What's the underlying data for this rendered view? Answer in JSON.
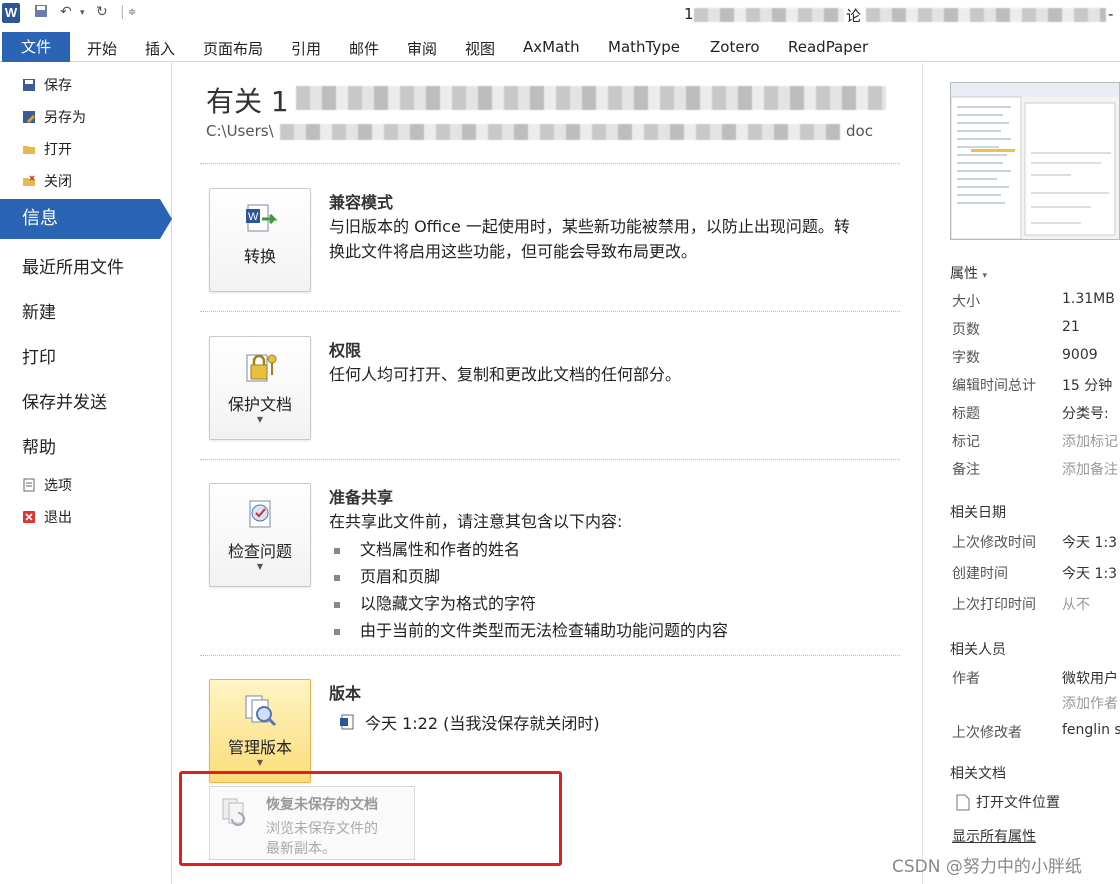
{
  "titlebar": {
    "title_prefix": "1",
    "title_suffix": "论",
    "title_end": "-"
  },
  "ribbon": {
    "file_tab": "文件",
    "tabs": [
      "开始",
      "插入",
      "页面布局",
      "引用",
      "邮件",
      "审阅",
      "视图",
      "AxMath",
      "MathType",
      "Zotero",
      "ReadPaper"
    ]
  },
  "nav": {
    "commands": [
      "保存",
      "另存为",
      "打开",
      "关闭"
    ],
    "info": "信息",
    "items": [
      "最近所用文件",
      "新建",
      "打印",
      "保存并发送",
      "帮助"
    ],
    "bottom": [
      "选项",
      "退出"
    ]
  },
  "main": {
    "title": "有关 1",
    "path_start": "C:\\Users\\",
    "path_end": "doc",
    "compat": {
      "button": "转换",
      "heading": "兼容模式",
      "text_line1": "与旧版本的 Office 一起使用时，某些新功能被禁用，以防止出现问题。转",
      "text_line2": "换此文件将启用这些功能，但可能会导致布局更改。"
    },
    "permissions": {
      "button": "保护文档",
      "heading": "权限",
      "text": "任何人均可打开、复制和更改此文档的任何部分。"
    },
    "share": {
      "button": "检查问题",
      "heading": "准备共享",
      "text": "在共享此文件前，请注意其包含以下内容:",
      "bullets": [
        "文档属性和作者的姓名",
        "页眉和页脚",
        "以隐藏文字为格式的字符",
        "由于当前的文件类型而无法检查辅助功能问题的内容"
      ]
    },
    "versions": {
      "button": "管理版本",
      "heading": "版本",
      "entry": "今天 1:22 (当我没保存就关闭时)"
    },
    "recover": {
      "title": "恢复未保存的文档",
      "desc_line1": "浏览未保存文件的",
      "desc_line2": "最新副本。"
    }
  },
  "props": {
    "heading": "属性",
    "rows": [
      {
        "k": "大小",
        "v": "1.31MB",
        "ph": false
      },
      {
        "k": "页数",
        "v": "21",
        "ph": false
      },
      {
        "k": "字数",
        "v": "9009",
        "ph": false
      },
      {
        "k": "编辑时间总计",
        "v": "15 分钟",
        "ph": false
      },
      {
        "k": "标题",
        "v": "分类号:",
        "ph": false
      },
      {
        "k": "标记",
        "v": "添加标记",
        "ph": true
      },
      {
        "k": "备注",
        "v": "添加备注",
        "ph": true
      }
    ],
    "dates_heading": "相关日期",
    "dates": [
      {
        "k": "上次修改时间",
        "v": "今天 1:3",
        "ph": false
      },
      {
        "k": "创建时间",
        "v": "今天 1:3",
        "ph": false
      },
      {
        "k": "上次打印时间",
        "v": "从不",
        "ph": true
      }
    ],
    "people_heading": "相关人员",
    "author_k": "作者",
    "author_v": "微软用户",
    "add_author": "添加作者",
    "lastmod_k": "上次修改者",
    "lastmod_v": "fenglin s",
    "docs_heading": "相关文档",
    "open_location": "打开文件位置",
    "show_all": "显示所有属性"
  },
  "watermark": "CSDN @努力中的小胖纸",
  "colors": {
    "accent": "#2b64b5",
    "highlight": "#e02020"
  }
}
